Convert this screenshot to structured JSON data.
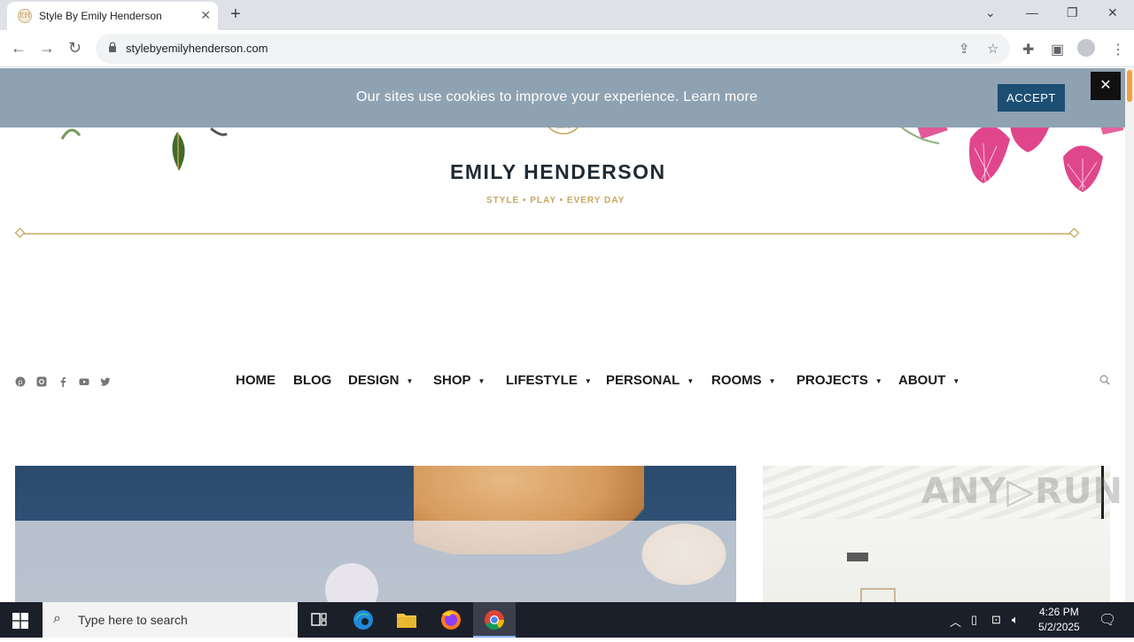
{
  "browser": {
    "tab_title": "Style By Emily Henderson",
    "tab_close": "✕",
    "new_tab": "+",
    "url": "stylebyemilyhenderson.com",
    "window_controls": {
      "dropdown": "⌄",
      "minimize": "—",
      "restore": "❐",
      "close": "✕"
    }
  },
  "cookie": {
    "text": "Our sites use cookies to improve your experience. Learn more",
    "accept_label": "ACCEPT",
    "close_label": "✕"
  },
  "site": {
    "logo_monogram": "EH",
    "brand": "EMILY HENDERSON",
    "tagline": "STYLE  •  PLAY  •  EVERY DAY"
  },
  "nav": {
    "items": [
      {
        "label": "HOME",
        "has_menu": false
      },
      {
        "label": "BLOG",
        "has_menu": false
      },
      {
        "label": "DESIGN",
        "has_menu": true
      },
      {
        "label": "SHOP",
        "has_menu": true
      },
      {
        "label": "LIFESTYLE",
        "has_menu": true
      },
      {
        "label": "PERSONAL",
        "has_menu": true
      },
      {
        "label": "ROOMS",
        "has_menu": true
      },
      {
        "label": "PROJECTS",
        "has_menu": true
      },
      {
        "label": "ABOUT",
        "has_menu": true
      }
    ],
    "caret": "▼",
    "social_icons": [
      "pinterest-icon",
      "instagram-icon",
      "facebook-icon",
      "youtube-icon",
      "twitter-icon"
    ]
  },
  "watermark": "ANY▷RUN",
  "taskbar": {
    "search_placeholder": "Type here to search",
    "time": "4:26 PM",
    "date": "5/2/2025"
  },
  "colors": {
    "cookie_bar": "#8fa2b2",
    "accept_button": "#1d4e73",
    "gold_accent": "#c8a660",
    "brand_text": "#1f2a36"
  }
}
